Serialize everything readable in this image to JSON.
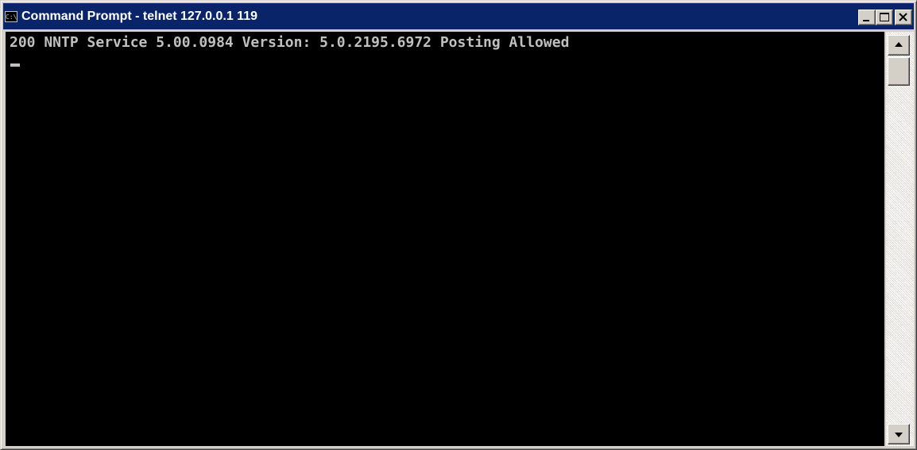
{
  "window": {
    "title": "Command Prompt - telnet 127.0.0.1 119",
    "icon": "console-icon",
    "icon_glyph": "C:\\",
    "title_bar_color": "#0a246a"
  },
  "title_buttons": {
    "minimize_icon": "minimize-icon",
    "maximize_icon": "maximize-icon",
    "close_icon": "close-icon"
  },
  "console": {
    "lines": [
      "200 NNTP Service 5.00.0984 Version: 5.0.2195.6972 Posting Allowed"
    ],
    "background": "#000000",
    "foreground": "#c0c0c0"
  },
  "scrollbar": {
    "up_icon": "scroll-up-arrow-icon",
    "down_icon": "scroll-down-arrow-icon"
  }
}
